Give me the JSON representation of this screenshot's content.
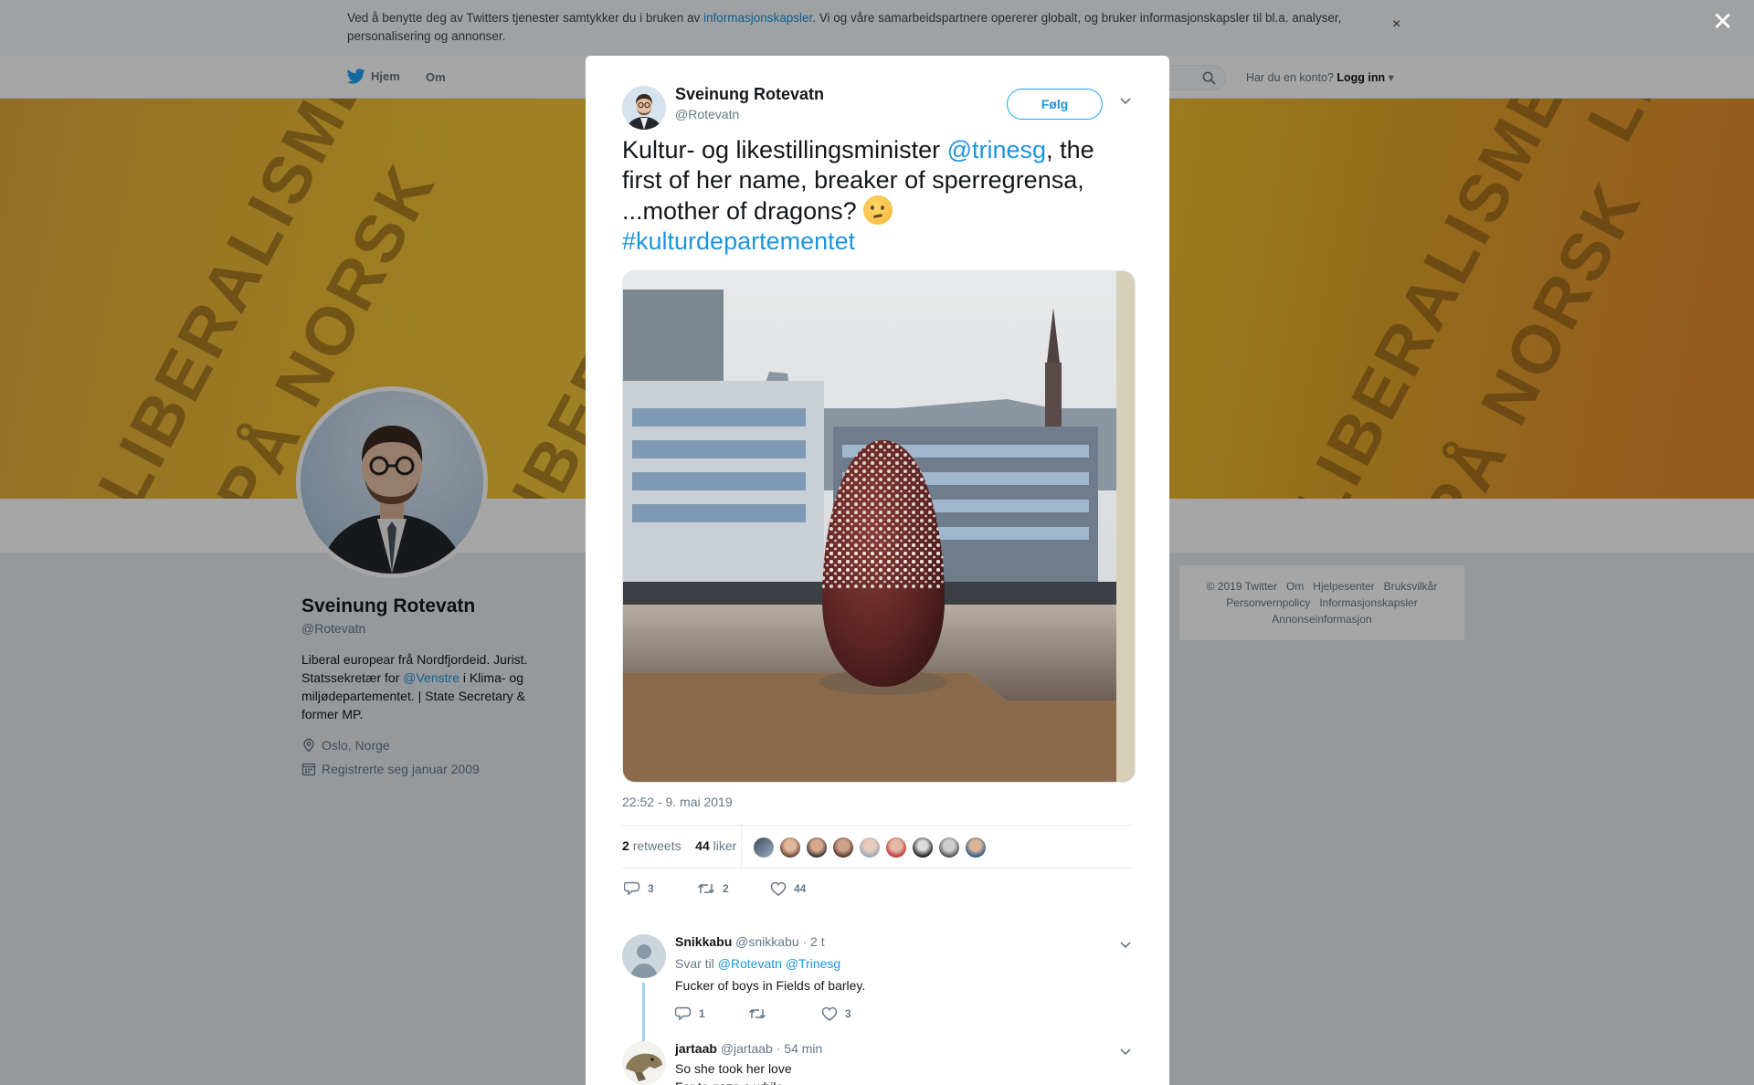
{
  "cookie_bar": {
    "text_before": "Ved å benytte deg av Twitters tjenester samtykker du i bruken av ",
    "link": "informasjonskapsler",
    "text_after": ". Vi og våre samarbeidspartnere opererer globalt, og bruker informasjonskapsler til bl.a. analyser, personalisering og annonser.",
    "close_glyph": "×"
  },
  "nav": {
    "home": "Hjem",
    "about": "Om",
    "login_prompt": "Har du en konto?",
    "login_link": "Logg inn"
  },
  "profile": {
    "name": "Sveinung Rotevatn",
    "handle": "@Rotevatn",
    "bio_1": "Liberal europear frå Nordfjordeid. Jurist. Statssekretær for ",
    "bio_mention": "@Venstre",
    "bio_2": " i Klima- og miljødepartementet. | State Secretary & former MP.",
    "location": "Oslo, Norge",
    "joined": "Registrerte seg januar 2009"
  },
  "banner_words": [
    "LIBERALISME",
    "PÅ NORSK"
  ],
  "footer": {
    "items": [
      "© 2019 Twitter",
      "Om",
      "Hjelpesenter",
      "Bruksvilkår",
      "Personvernpolicy",
      "Informasjonskapsler",
      "Annonseinformasjon"
    ]
  },
  "overlay": {
    "close_glyph": "✕"
  },
  "tweet": {
    "author_name": "Sveinung Rotevatn",
    "author_handle": "@Rotevatn",
    "follow_label": "Følg",
    "text_1": "Kultur- og likestillingsminister ",
    "mention": "@trinesg",
    "text_2": ", the first of her name, breaker of sperregrensa, ...mother of dragons? ",
    "hashtag": "#kulturdepartementet",
    "timestamp": "22:52 - 9. mai 2019",
    "retweets_count": "2",
    "retweets_label": "retweets",
    "likes_count": "44",
    "likes_label": "liker",
    "actions": {
      "replies": "3",
      "retweets": "2",
      "likes": "44"
    }
  },
  "replies": [
    {
      "name": "Snikkabu",
      "handle": "@snikkabu",
      "time": "· 2 t",
      "reply_to_label": "Svar til",
      "reply_to_1": "@Rotevatn",
      "reply_to_2": "@Trinesg",
      "text": "Fucker of boys in Fields of barley.",
      "actions": {
        "replies": "1",
        "retweets": "",
        "likes": "3"
      }
    },
    {
      "name": "jartaab",
      "handle": "@jartaab",
      "time": "· 54 min",
      "text_1": "So she took her love",
      "text_2": "For to gaze a while"
    }
  ],
  "colors": {
    "accent": "#1da1f2",
    "link": "#1b95e0",
    "overlay": "rgba(0,0,0,0.35)",
    "thread_line": "#a2d2f0"
  }
}
